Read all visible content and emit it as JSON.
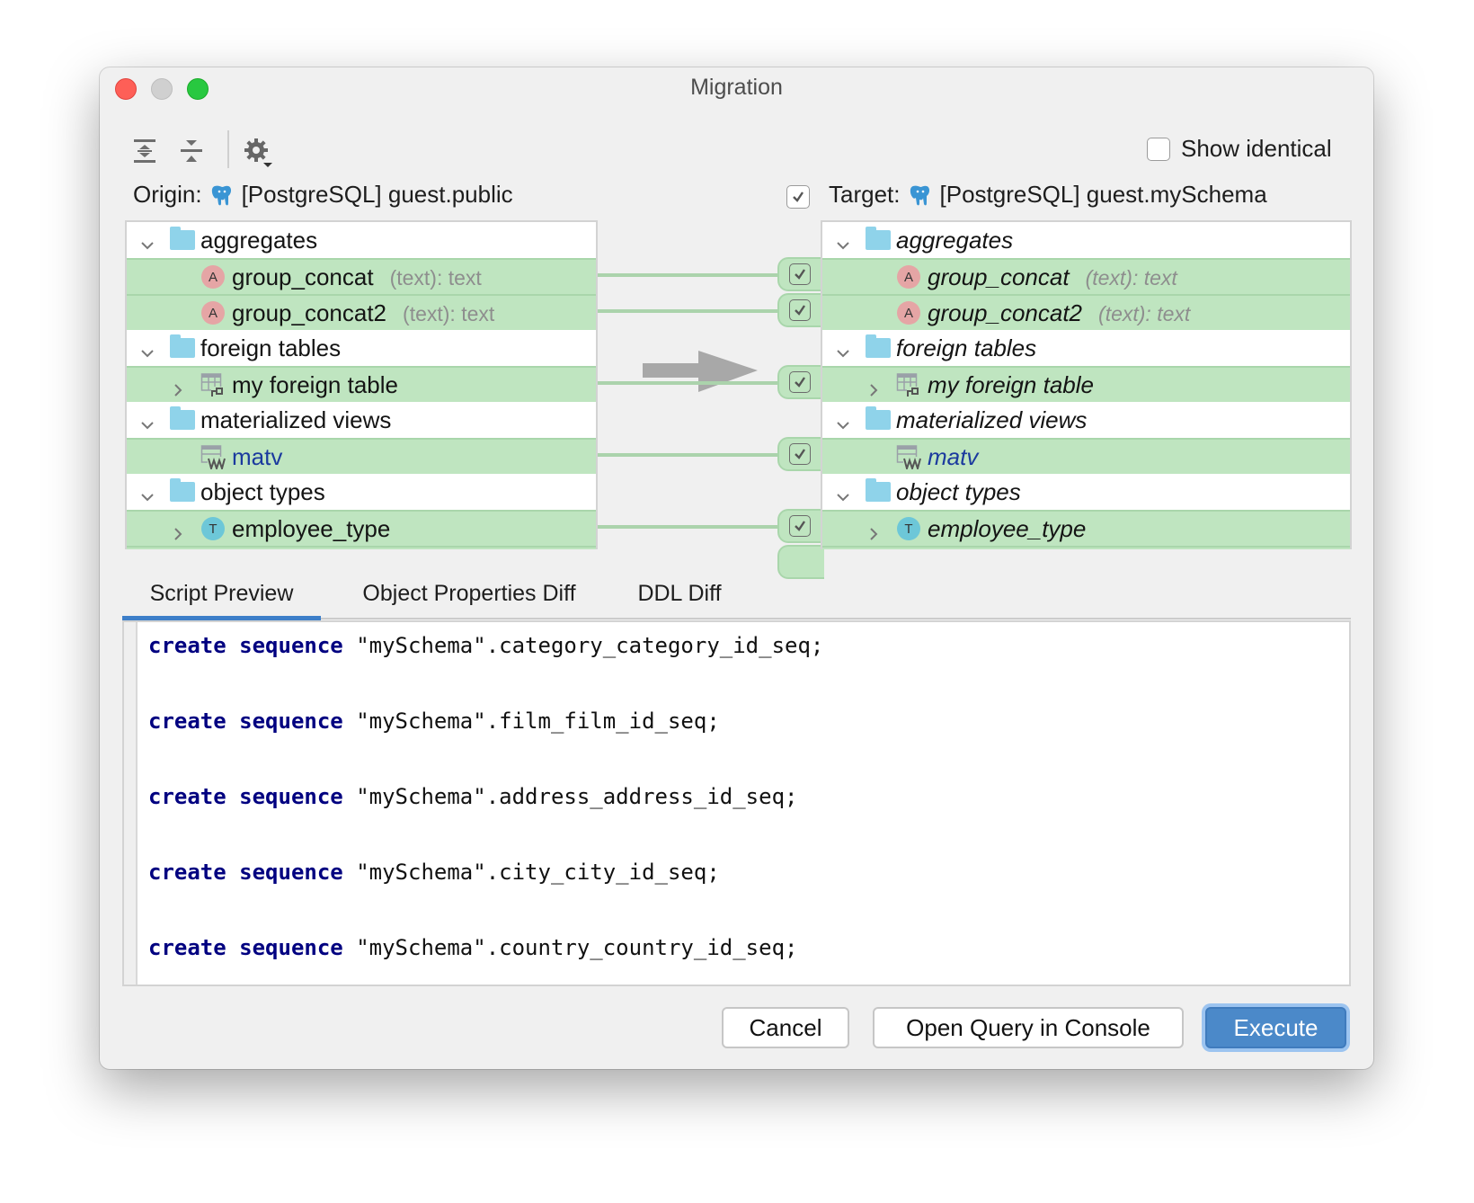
{
  "window": {
    "title": "Migration",
    "controls": [
      "close",
      "minimize",
      "maximize"
    ]
  },
  "toolbar": {
    "expand_all_icon": "expand-all-icon",
    "collapse_all_icon": "collapse-all-icon",
    "settings_icon": "gear-with-dropdown-icon",
    "show_identical_label": "Show identical",
    "show_identical_checked": false
  },
  "origin": {
    "label": "Origin:",
    "db_icon": "postgresql-elephant-icon",
    "source": "[PostgreSQL] guest.public"
  },
  "target": {
    "checked": true,
    "label": "Target:",
    "db_icon": "postgresql-elephant-icon",
    "source": "[PostgreSQL] guest.mySchema"
  },
  "tree": {
    "rows": [
      {
        "kind": "folder",
        "label": "aggregates",
        "expanded": true,
        "changed": false
      },
      {
        "kind": "aggregate",
        "icon_letter": "A",
        "label": "group_concat",
        "signature": "(text): text",
        "changed": true,
        "checked": true
      },
      {
        "kind": "aggregate",
        "icon_letter": "A",
        "label": "group_concat2",
        "signature": "(text): text",
        "changed": true,
        "checked": true
      },
      {
        "kind": "folder",
        "label": "foreign tables",
        "expanded": true,
        "changed": false
      },
      {
        "kind": "foreign-table",
        "label": "my foreign table",
        "expandable": true,
        "changed": true,
        "checked": true
      },
      {
        "kind": "folder",
        "label": "materialized views",
        "expanded": true,
        "changed": false
      },
      {
        "kind": "mat-view",
        "label": "matv",
        "changed": true,
        "checked": true
      },
      {
        "kind": "folder",
        "label": "object types",
        "expanded": true,
        "changed": false
      },
      {
        "kind": "object-type",
        "icon_letter": "T",
        "label": "employee_type",
        "expandable": true,
        "changed": true,
        "checked": true
      }
    ]
  },
  "tabs": [
    {
      "label": "Script Preview",
      "active": true
    },
    {
      "label": "Object Properties Diff",
      "active": false
    },
    {
      "label": "DDL Diff",
      "active": false
    }
  ],
  "script": {
    "lines": [
      {
        "kw": "create sequence",
        "rest": " \"mySchema\".category_category_id_seq;"
      },
      {
        "kw": "create sequence",
        "rest": " \"mySchema\".film_film_id_seq;"
      },
      {
        "kw": "create sequence",
        "rest": " \"mySchema\".address_address_id_seq;"
      },
      {
        "kw": "create sequence",
        "rest": " \"mySchema\".city_city_id_seq;"
      },
      {
        "kw": "create sequence",
        "rest": " \"mySchema\".country_country_id_seq;"
      }
    ]
  },
  "buttons": {
    "cancel": "Cancel",
    "open_console": "Open Query in Console",
    "execute": "Execute"
  },
  "colors": {
    "changed_row": "#bfe5c0",
    "folder": "#8fd3ea",
    "accent": "#4b89c9",
    "keyword": "#000080",
    "link": "#1b3a9e"
  }
}
